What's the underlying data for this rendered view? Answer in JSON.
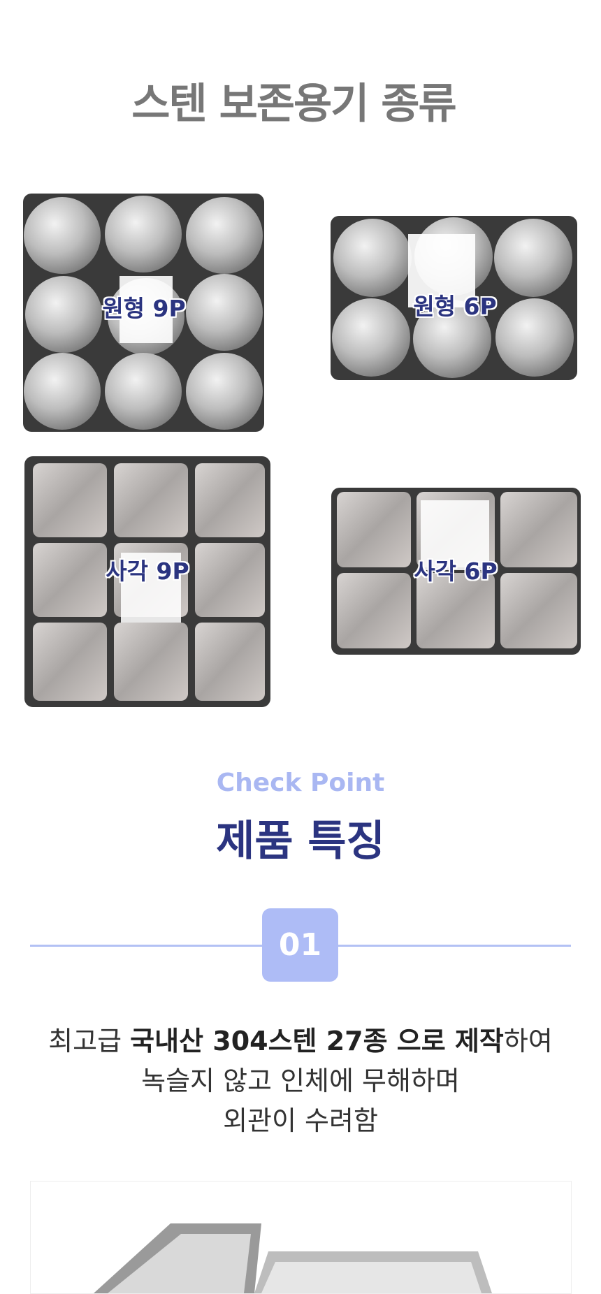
{
  "header": {
    "title": "스텐 보존용기 종류"
  },
  "products": [
    {
      "label": "원형 9P",
      "shape": "round",
      "grid": [
        3,
        3
      ]
    },
    {
      "label": "원형 6P",
      "shape": "round",
      "grid": [
        3,
        2
      ]
    },
    {
      "label": "사각 9P",
      "shape": "square",
      "grid": [
        3,
        3
      ]
    },
    {
      "label": "사각 6P",
      "shape": "square",
      "grid": [
        3,
        2
      ]
    }
  ],
  "features": {
    "subtitle": "Check Point",
    "title": "제품 특징",
    "badge": "01",
    "description": {
      "line1_a": "최고급 ",
      "line1_b": "국내산 304스텐 27종 으로 제작",
      "line1_c": "하여",
      "line2": "녹슬지 않고 인체에 무해하며",
      "line3": "외관이 수려함"
    }
  },
  "colors": {
    "accent": "#2b3480",
    "light_accent": "#aebcf6",
    "title_gray": "#777777"
  }
}
